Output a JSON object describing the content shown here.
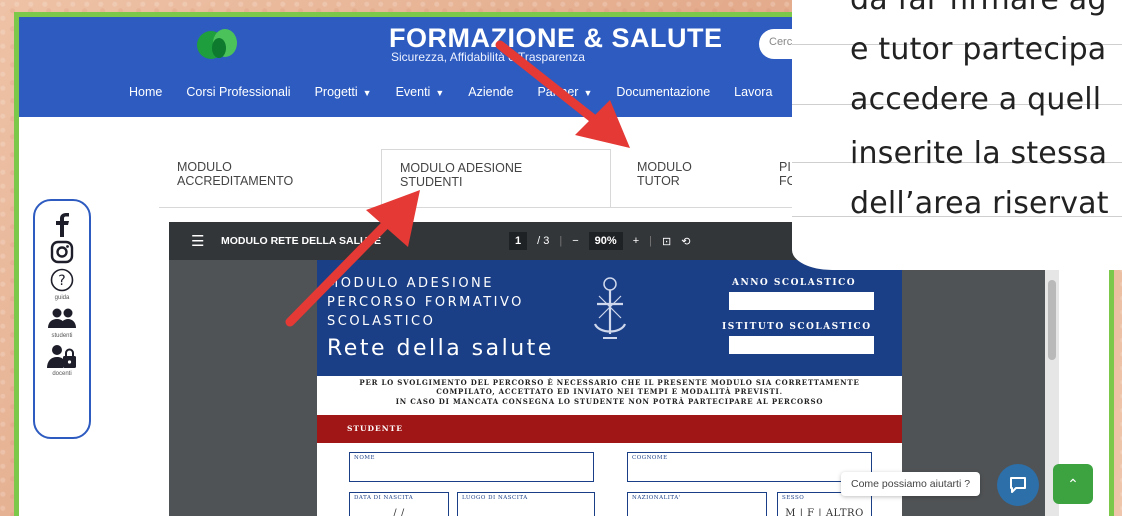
{
  "header": {
    "brand": "FORMAZIONE & SALUTE",
    "tagline": "Sicurezza, Affidabilità e Trasparenza",
    "search_placeholder": "Cerca",
    "nav": [
      {
        "label": "Home",
        "dropdown": false
      },
      {
        "label": "Corsi Professionali",
        "dropdown": false
      },
      {
        "label": "Progetti",
        "dropdown": true
      },
      {
        "label": "Eventi",
        "dropdown": true
      },
      {
        "label": "Aziende",
        "dropdown": false
      },
      {
        "label": "Partner",
        "dropdown": true
      },
      {
        "label": "Documentazione",
        "dropdown": false
      },
      {
        "label": "Lavora",
        "dropdown": false
      }
    ]
  },
  "tabs": [
    {
      "label": "MODULO\nACCREDITAMENTO",
      "active": false
    },
    {
      "label": "MODULO ADESIONE\nSTUDENTI",
      "active": true
    },
    {
      "label": "MODULO\nTUTOR",
      "active": false
    },
    {
      "label": "PI\nFC",
      "active": false
    }
  ],
  "social": {
    "items": [
      {
        "icon": "facebook-icon",
        "caption": ""
      },
      {
        "icon": "instagram-icon",
        "caption": ""
      },
      {
        "icon": "help-icon",
        "caption": "guida"
      },
      {
        "icon": "students-icon",
        "caption": "studenti"
      },
      {
        "icon": "teacher-lock-icon",
        "caption": "docenti"
      }
    ]
  },
  "pdf": {
    "title": "MODULO RETE DELLA SALUTE",
    "page_current": "1",
    "page_total": "/ 3",
    "zoom": "90%"
  },
  "document": {
    "heading": "MODULO ADESIONE\nPERCORSO FORMATIVO\nSCOLASTICO",
    "network": "Rete della salute",
    "year_label": "ANNO SCOLASTICO",
    "school_label": "ISTITUTO SCOLASTICO",
    "note": "PER LO SVOLGIMENTO DEL PERCORSO È NECESSARIO CHE IL PRESENTE MODULO SIA CORRETTAMENTE\nCOMPILATO, ACCETTATO ED INVIATO NEI TEMPI E MODALITÀ PREVISTI.\nIN CASO DI MANCATA CONSEGNA LO STUDENTE NON POTRÀ PARTECIPARE AL PERCORSO",
    "section": "STUDENTE",
    "fields": {
      "nome": "NOME",
      "cognome": "COGNOME",
      "data_nascita": "DATA DI NASCITA",
      "data_nascita_value": "/    /",
      "luogo_nascita": "LUOGO DI NASCITA",
      "nazionalita": "NAZIONALITA'",
      "sesso": "SESSO",
      "sesso_value": "M | F | ALTRO"
    }
  },
  "chat": {
    "prompt": "Come possiamo aiutarti ?"
  },
  "overlay": {
    "lines": [
      "da far firmare ag",
      "e tutor partecipa",
      "accedere a quell",
      "inserite la stessa",
      "dell’area riservat"
    ]
  },
  "colors": {
    "header_blue": "#2d5bc0",
    "frame_green": "#7cc84a",
    "arrow_red": "#e53935",
    "doc_navy": "#1b3f86",
    "doc_red": "#a01616"
  }
}
